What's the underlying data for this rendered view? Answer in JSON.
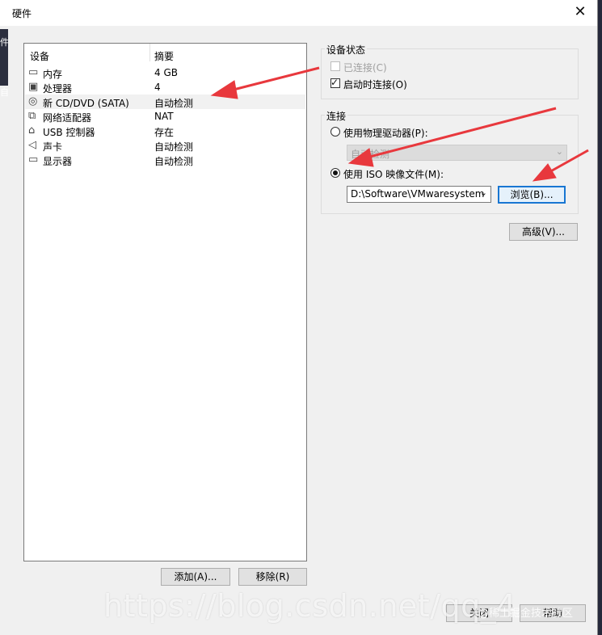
{
  "window": {
    "title": "硬件",
    "close_glyph": "✕"
  },
  "device_list": {
    "headers": {
      "device": "设备",
      "summary": "摘要"
    },
    "rows": [
      {
        "name": "内存",
        "summary": "4 GB",
        "icon": "memory-icon"
      },
      {
        "name": "处理器",
        "summary": "4",
        "icon": "processor-icon"
      },
      {
        "name": "新 CD/DVD (SATA)",
        "summary": "自动检测",
        "icon": "cd-dvd-icon",
        "selected": true
      },
      {
        "name": "网络适配器",
        "summary": "NAT",
        "icon": "network-adapter-icon"
      },
      {
        "name": "USB 控制器",
        "summary": "存在",
        "icon": "usb-icon"
      },
      {
        "name": "声卡",
        "summary": "自动检测",
        "icon": "sound-card-icon"
      },
      {
        "name": "显示器",
        "summary": "自动检测",
        "icon": "display-icon"
      }
    ]
  },
  "buttons": {
    "add": "添加(A)...",
    "remove": "移除(R)",
    "advanced": "高级(V)...",
    "browse": "浏览(B)...",
    "close": "关闭",
    "help": "帮助"
  },
  "device_status": {
    "label": "设备状态",
    "connected": {
      "label": "已连接(C)",
      "checked": false,
      "disabled": true
    },
    "connect_at_power_on": {
      "label": "启动时连接(O)",
      "checked": true
    }
  },
  "connection": {
    "label": "连接",
    "physical_drive": {
      "label": "使用物理驱动器(P):",
      "selected": false,
      "value": "自动检测"
    },
    "iso_image": {
      "label": "使用 ISO 映像文件(M):",
      "selected": true,
      "value": "D:\\Software\\VMwaresystem"
    }
  },
  "watermark": {
    "text": "https://blog.csdn.net/qq_4",
    "overlay_right": "@稀土掘金技术社区"
  },
  "edge_left_text": [
    "件",
    "自"
  ],
  "colors": {
    "window_bg": "#f0f0f0",
    "annotation_arrow": "#e8383d",
    "focus_border": "#1876d2"
  }
}
